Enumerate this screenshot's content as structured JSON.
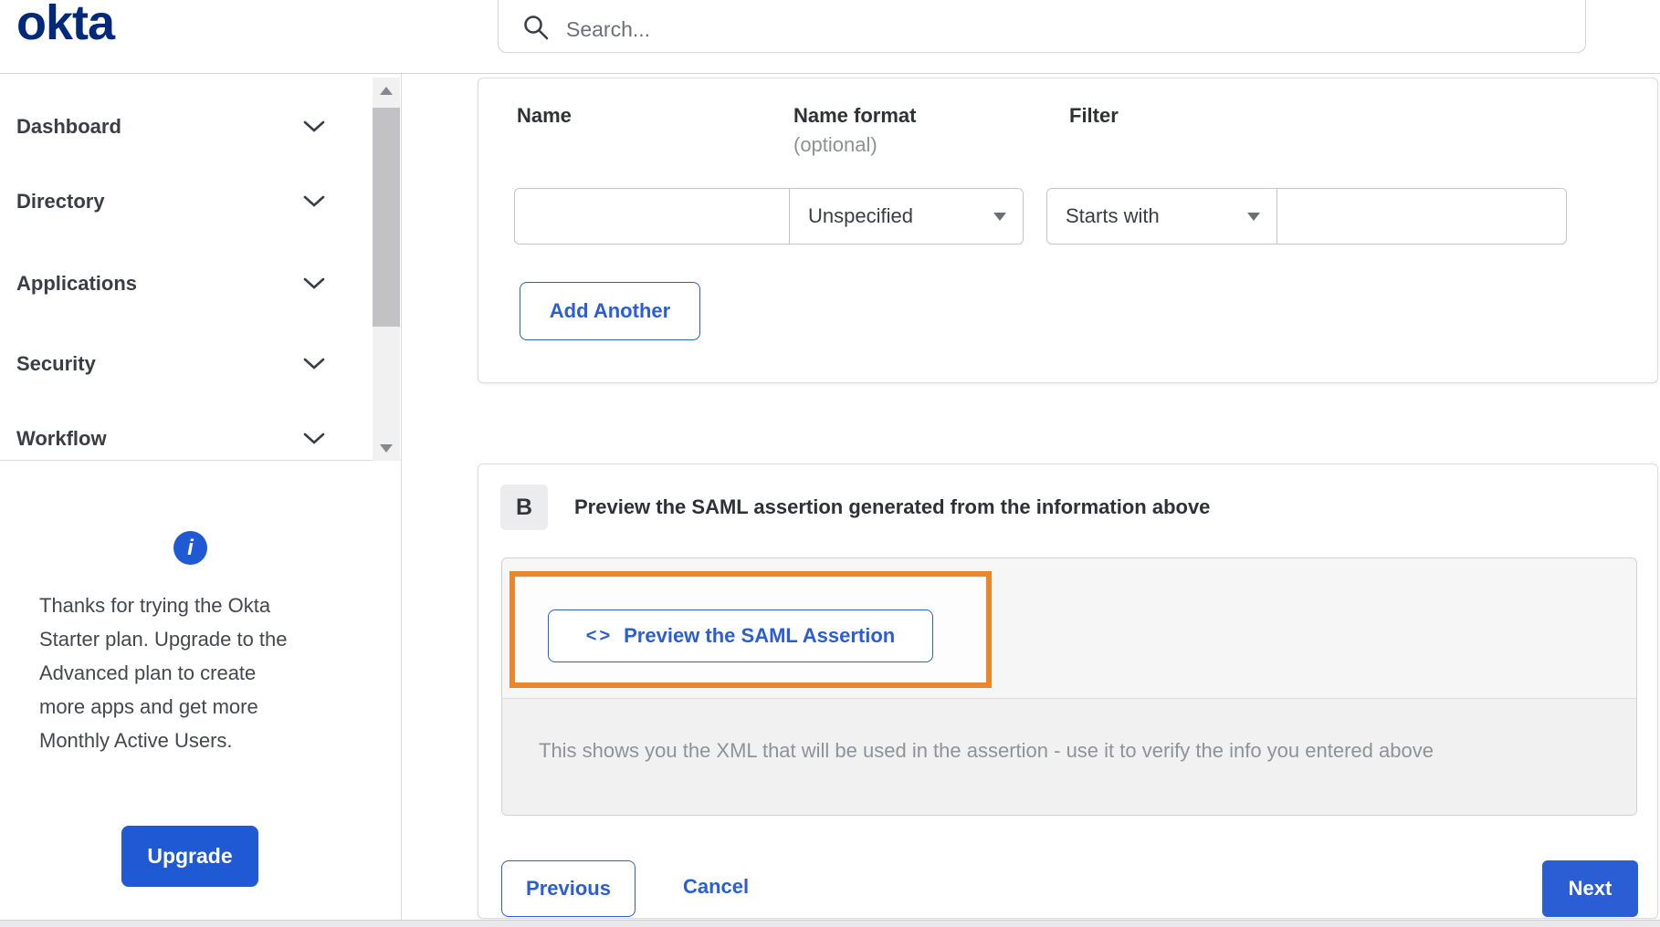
{
  "header": {
    "logo_text": "okta",
    "search_placeholder": "Search..."
  },
  "sidebar": {
    "items": [
      {
        "label": "Dashboard"
      },
      {
        "label": "Directory"
      },
      {
        "label": "Applications"
      },
      {
        "label": "Security"
      },
      {
        "label": "Workflow"
      }
    ],
    "trial_notice": {
      "text": "Thanks for trying the Okta Starter plan. Upgrade to the Advanced plan to create more apps and get more Monthly Active Users.",
      "upgrade_label": "Upgrade"
    }
  },
  "attribute_form": {
    "columns": {
      "name_label": "Name",
      "name_format_label": "Name format",
      "name_format_sub": "(optional)",
      "filter_label": "Filter"
    },
    "name_value": "",
    "name_format_value": "Unspecified",
    "filter_type_value": "Starts with",
    "filter_value": "",
    "add_another_label": "Add Another"
  },
  "preview_section": {
    "badge": "B",
    "title": "Preview the SAML assertion generated from the information above",
    "button_icon_glyph": "<>",
    "button_label": "Preview the SAML Assertion",
    "description": "This shows you the XML that will be used in the assertion - use it to verify the info you entered above"
  },
  "footer": {
    "previous_label": "Previous",
    "cancel_label": "Cancel",
    "next_label": "Next"
  },
  "colors": {
    "accent_blue": "#2b5dd5",
    "logo_navy": "#00297a",
    "highlight_orange": "#e8872e"
  }
}
